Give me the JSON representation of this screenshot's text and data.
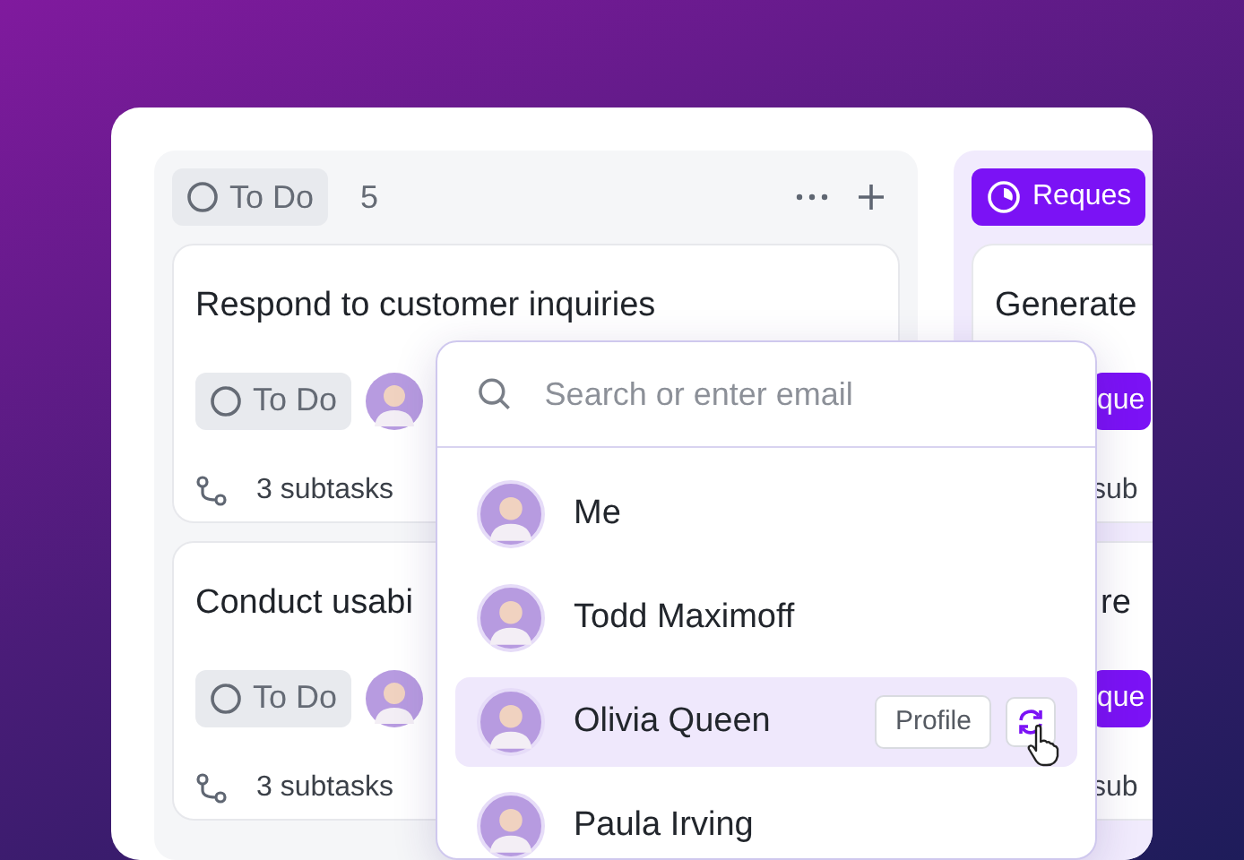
{
  "board": {
    "columns": [
      {
        "kind": "todo",
        "status": "To Do",
        "count": "5",
        "cards": [
          {
            "title": "Respond to customer inquiries",
            "status": "To Do",
            "subtasks": "3 subtasks"
          },
          {
            "title": "Conduct usabi",
            "status": "To Do",
            "subtasks": "3 subtasks"
          }
        ]
      },
      {
        "kind": "request",
        "status": "Reques",
        "cards": [
          {
            "title": "Generate",
            "status": "que",
            "subtasks": "sub"
          },
          {
            "title": "re",
            "status": "que",
            "subtasks": "sub"
          }
        ]
      }
    ]
  },
  "assignee_popup": {
    "search": {
      "placeholder": "Search or enter email"
    },
    "people": [
      {
        "name": "Me",
        "selected": false
      },
      {
        "name": "Todd Maximoff",
        "selected": false
      },
      {
        "name": "Olivia Queen",
        "selected": true,
        "actions": [
          "Profile"
        ]
      },
      {
        "name": "Paula Irving",
        "selected": false
      }
    ]
  }
}
